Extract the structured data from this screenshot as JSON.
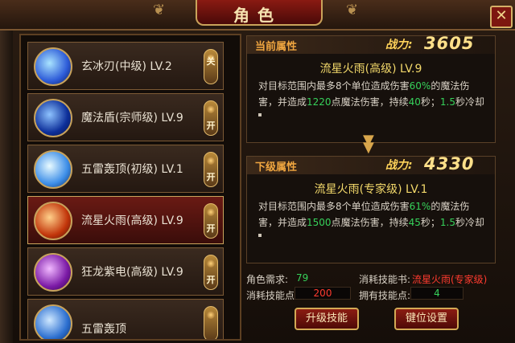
{
  "window": {
    "title": "角色",
    "close_symbol": "✕"
  },
  "skills": [
    {
      "name": "玄冰刃(中级) LV.2",
      "toggle": "关",
      "colors": [
        "#a9e4ff",
        "#2d5bd8"
      ],
      "active": false
    },
    {
      "name": "魔法盾(宗师级) LV.9",
      "toggle": "开",
      "colors": [
        "#8ec3ff",
        "#0d2f9a"
      ],
      "active": false
    },
    {
      "name": "五雷轰顶(初级) LV.1",
      "toggle": "开",
      "colors": [
        "#e9fbff",
        "#3d8ee8"
      ],
      "active": false
    },
    {
      "name": "流星火雨(高级) LV.9",
      "toggle": "开",
      "colors": [
        "#ffd08a",
        "#c2360b"
      ],
      "active": true
    },
    {
      "name": "狂龙紫电(高级) LV.9",
      "toggle": "开",
      "colors": [
        "#f1b8ff",
        "#7b1aa6"
      ],
      "active": false
    },
    {
      "name": "五雷轰顶",
      "toggle": "",
      "colors": [
        "#cfe8ff",
        "#2c6fd0"
      ],
      "active": false
    }
  ],
  "current": {
    "label": "当前属性",
    "power_label": "战力:",
    "power": "3605",
    "skill_name": "流星火雨(高级) LV.9",
    "desc_a": "对目标范围内最多8个单位造成伤害",
    "pct": "60%",
    "desc_b": "的魔法伤害，并造成",
    "dmg": "1220",
    "desc_c": "点魔法伤害，持续",
    "dur": "40",
    "desc_d": "秒；",
    "cd": "1.5",
    "desc_e": "秒冷却"
  },
  "next": {
    "label": "下级属性",
    "power_label": "战力:",
    "power": "4330",
    "skill_name": "流星火雨(专家级) LV.1",
    "desc_a": "对目标范围内最多8个单位造成伤害",
    "pct": "61%",
    "desc_b": "的魔法伤害，并造成",
    "dmg": "1500",
    "desc_c": "点魔法伤害，持续",
    "dur": "45",
    "desc_d": "秒；",
    "cd": "1.5",
    "desc_e": "秒冷却"
  },
  "requirements": {
    "level_label": "角色需求:",
    "level_value": "79",
    "book_label": "消耗技能书:",
    "book_value": "流星火雨(专家级)",
    "points_label": "消耗技能点:",
    "points_value": "200",
    "owned_label": "拥有技能点:",
    "owned_value": "4"
  },
  "buttons": {
    "upgrade": "升级技能",
    "keybind": "键位设置"
  },
  "colors": {
    "gold": "#f2d86a",
    "green": "#36d15a",
    "red": "#ff3b2f",
    "accent": "#8b1c12"
  }
}
